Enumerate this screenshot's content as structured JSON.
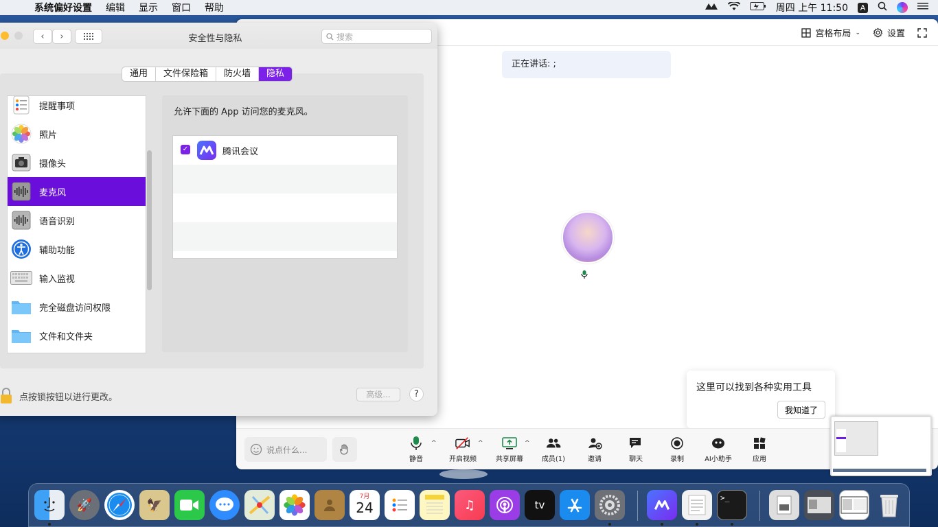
{
  "menubar": {
    "app_name": "系统偏好设置",
    "items": [
      "编辑",
      "显示",
      "窗口",
      "帮助"
    ],
    "clock": "周四 上午 11:50",
    "input_method": "A"
  },
  "meeting": {
    "layout_label": "宫格布局",
    "settings_label": "设置",
    "speaking_text": "正在讲话: ;",
    "tooltip_text": "这里可以找到各种实用工具",
    "tooltip_button": "我知道了",
    "chat_placeholder": "说点什么...",
    "toolbar": {
      "mute": "静音",
      "video": "开启视频",
      "share": "共享屏幕",
      "members": "成员(1)",
      "invite": "邀请",
      "chat": "聊天",
      "record": "录制",
      "ai": "AI小助手",
      "apps": "应用"
    }
  },
  "prefs": {
    "title": "安全性与隐私",
    "search_placeholder": "搜索",
    "tabs": [
      "通用",
      "文件保险箱",
      "防火墙",
      "隐私"
    ],
    "active_tab": "隐私",
    "sidebar": [
      {
        "label": "提醒事项"
      },
      {
        "label": "照片"
      },
      {
        "label": "摄像头"
      },
      {
        "label": "麦克风"
      },
      {
        "label": "语音识别"
      },
      {
        "label": "辅助功能"
      },
      {
        "label": "输入监视"
      },
      {
        "label": "完全磁盘访问权限"
      },
      {
        "label": "文件和文件夹"
      }
    ],
    "selected_item": "麦克风",
    "description": "允许下面的 App 访问您的麦克风。",
    "apps": [
      {
        "name": "腾讯会议",
        "checked": true
      }
    ],
    "lock_text": "点按锁按钮以进行更改。",
    "advanced_label": "高级...",
    "help_label": "?"
  },
  "dock": {
    "calendar_month": "7月",
    "calendar_day": "24",
    "tv_label": "tv"
  },
  "colors": {
    "accent": "#6a0edb",
    "menubar_bg": "#eceff3",
    "desktop": "#1d4b8c"
  }
}
